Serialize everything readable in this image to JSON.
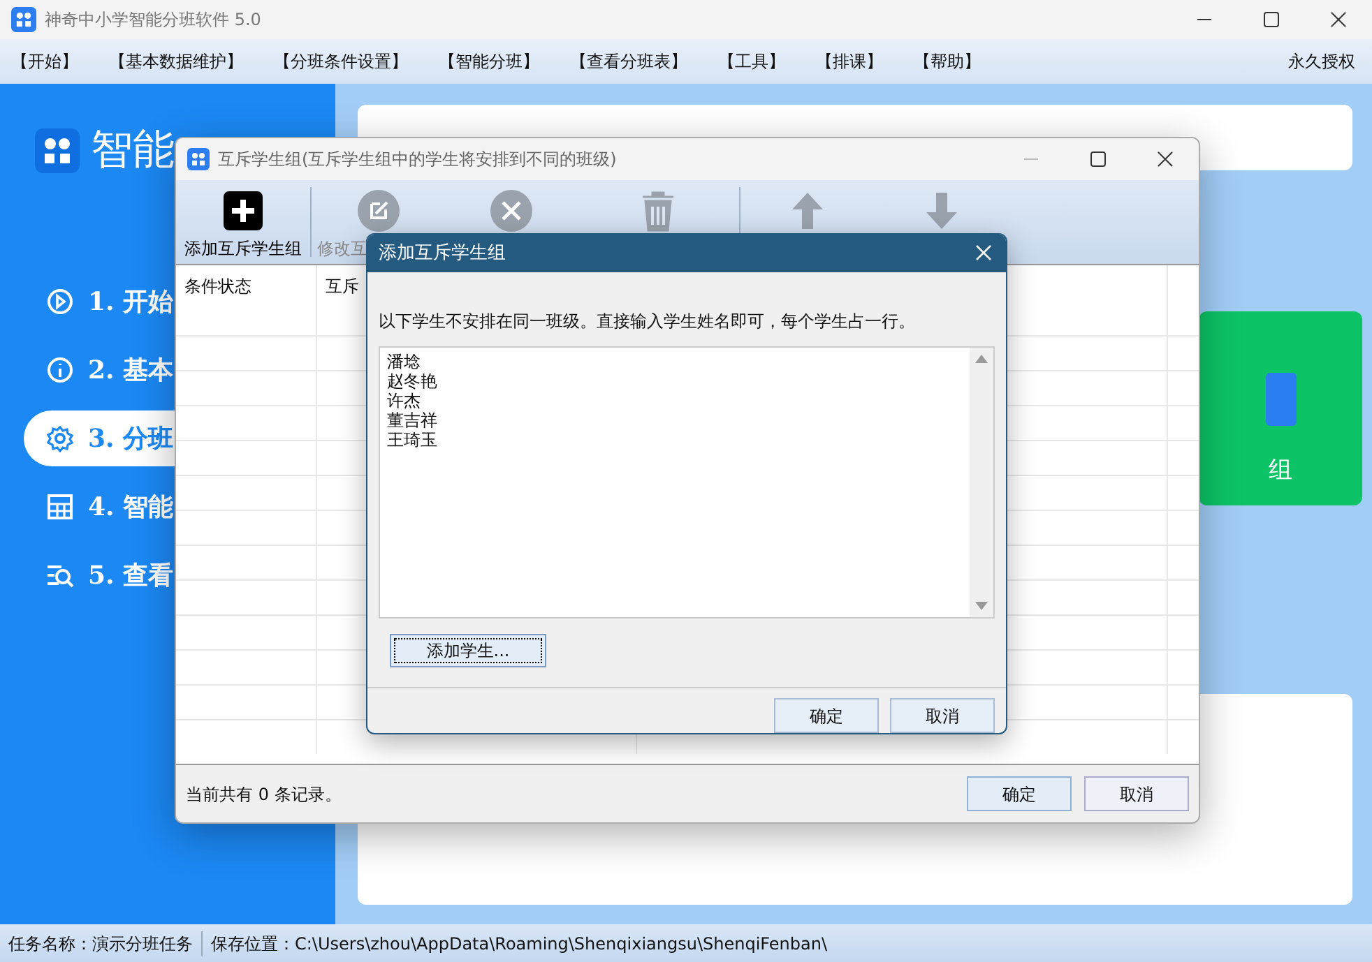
{
  "window": {
    "title": "神奇中小学智能分班软件 5.0"
  },
  "menu": [
    {
      "label": "【开始】"
    },
    {
      "label": "【基本数据维护】"
    },
    {
      "label": "【分班条件设置】"
    },
    {
      "label": "【智能分班】"
    },
    {
      "label": "【查看分班表】"
    },
    {
      "label": "【工具】"
    },
    {
      "label": "【排课】"
    },
    {
      "label": "【帮助】"
    }
  ],
  "license": "永久授权",
  "sidebar": {
    "title": "智能",
    "items": [
      {
        "label": "1. 开始",
        "selected": false
      },
      {
        "label": "2. 基本",
        "selected": false
      },
      {
        "label": "3. 分班",
        "selected": true
      },
      {
        "label": "4. 智能",
        "selected": false
      },
      {
        "label": "5. 查看",
        "selected": false
      }
    ]
  },
  "content": {
    "card_label": "组"
  },
  "group_window": {
    "title": "互斥学生组(互斥学生组中的学生将安排到不同的班级)",
    "toolbar": [
      {
        "label": "添加互斥学生组",
        "disabled": false
      },
      {
        "label": "修改互",
        "disabled": true
      },
      {
        "disabled": true
      },
      {
        "disabled": true
      },
      {
        "disabled": true
      },
      {
        "disabled": true
      }
    ],
    "table": {
      "columns": [
        "条件状态",
        "互斥"
      ]
    },
    "record_count": "当前共有 0 条记录。",
    "buttons": [
      "确定",
      "取消"
    ]
  },
  "add_dialog": {
    "title": "添加互斥学生组",
    "instruction": "以下学生不安排在同一班级。直接输入学生姓名即可，每个学生占一行。",
    "names": [
      "潘埝",
      "赵冬艳",
      "许杰",
      "董吉祥",
      "王琦玉"
    ],
    "add_button": "添加学生...",
    "buttons": [
      "确定",
      "取消"
    ]
  },
  "status_bar": {
    "task": "任务名称：演示分班任务",
    "path": "保存位置：C:\\Users\\zhou\\AppData\\Roaming\\Shenqixiangsu\\ShenqiFenban\\"
  }
}
